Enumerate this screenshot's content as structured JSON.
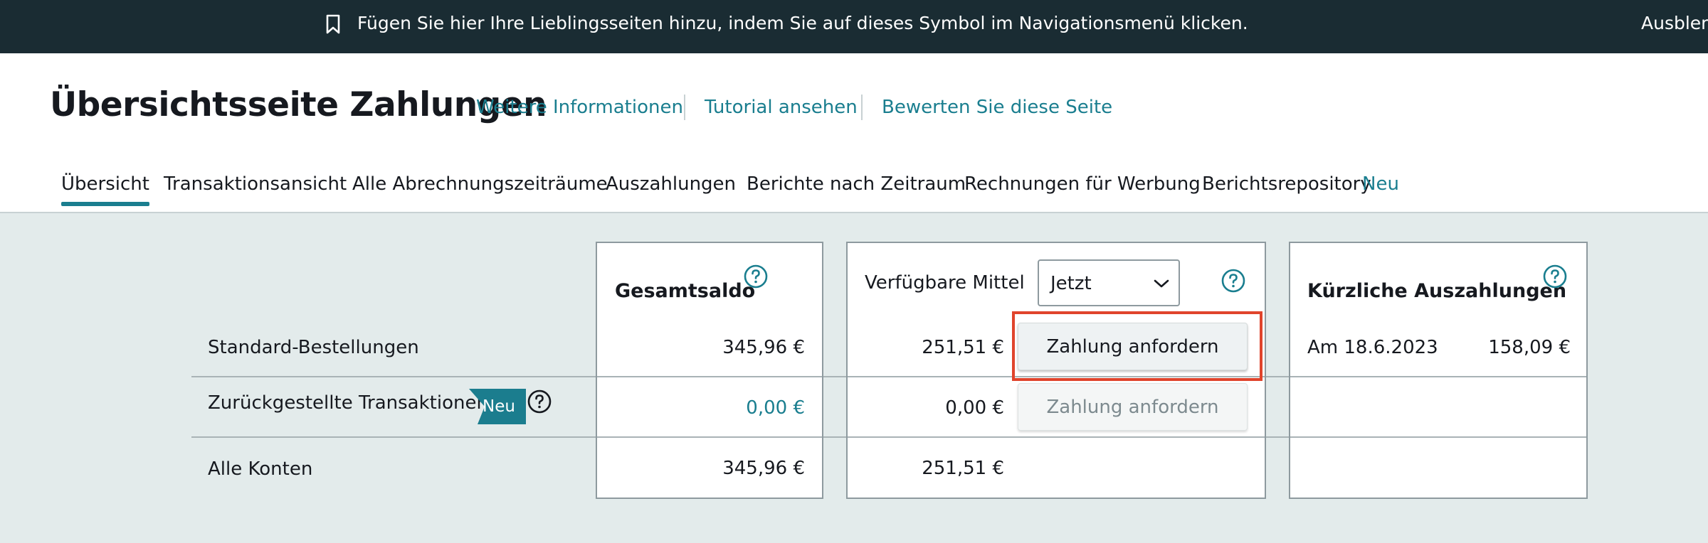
{
  "banner": {
    "message": "Fügen Sie hier Ihre Lieblingsseiten hinzu, indem Sie auf dieses Symbol im Navigationsmenü klicken.",
    "hide_label": "Ausblen",
    "icon": "bookmark-icon"
  },
  "header": {
    "title": "Übersichtsseite Zahlungen",
    "links": [
      "Weitere Informationen",
      "Tutorial ansehen",
      "Bewerten Sie diese Seite"
    ]
  },
  "tabs": [
    {
      "label": "Übersicht",
      "active": true
    },
    {
      "label": "Transaktionsansicht"
    },
    {
      "label": "Alle Abrechnungszeiträume"
    },
    {
      "label": "Auszahlungen"
    },
    {
      "label": "Berichte nach Zeitraum"
    },
    {
      "label": "Rechnungen für Werbung"
    },
    {
      "label": "Berichtsrepository",
      "badge": "Neu"
    }
  ],
  "rows": {
    "standard": "Standard-Bestellungen",
    "deferred": "Zurückgestellte Transaktionen",
    "deferred_badge": "Neu",
    "all": "Alle Konten"
  },
  "total_balance": {
    "title": "Gesamtsaldo",
    "standard": "345,96 €",
    "deferred": "0,00 €",
    "all": "345,96 €"
  },
  "available_funds": {
    "title": "Verfügbare Mittel",
    "select_value": "Jetzt",
    "standard": "251,51 €",
    "deferred": "0,00 €",
    "all": "251,51 €",
    "request_button": "Zahlung anfordern",
    "request_button_disabled": "Zahlung anfordern"
  },
  "recent_payouts": {
    "title": "Kürzliche Auszahlungen",
    "date": "Am 18.6.2023",
    "amount": "158,09 €"
  },
  "colors": {
    "banner_bg": "#1a2c33",
    "accent": "#1a7e8f",
    "content_bg": "#e3ebeb",
    "highlight": "#e0442c"
  }
}
